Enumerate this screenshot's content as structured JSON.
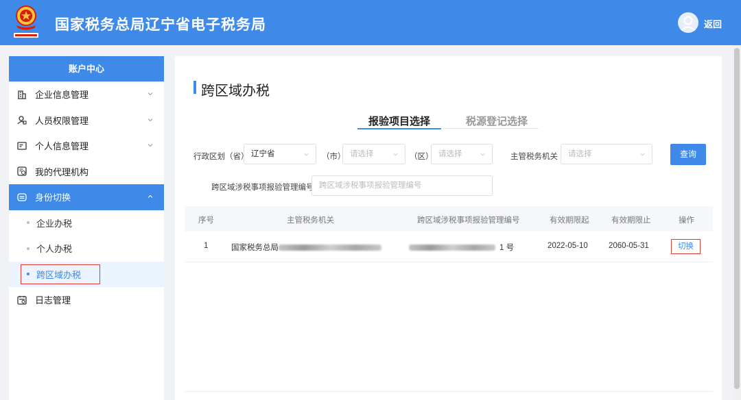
{
  "header": {
    "title": "国家税务总局辽宁省电子税务局",
    "back_label": "返回"
  },
  "sidebar": {
    "heading": "账户中心",
    "items": [
      {
        "label": "企业信息管理",
        "icon": "building-icon"
      },
      {
        "label": "人员权限管理",
        "icon": "user-lock-icon"
      },
      {
        "label": "个人信息管理",
        "icon": "id-card-icon"
      },
      {
        "label": "我的代理机构",
        "icon": "agency-icon"
      },
      {
        "label": "身份切换",
        "icon": "switch-icon"
      }
    ],
    "sub_items": [
      "企业办税",
      "个人办税",
      "跨区域办税"
    ],
    "last_item": {
      "label": "日志管理",
      "icon": "log-icon"
    }
  },
  "main": {
    "title": "跨区域办税",
    "tabs": [
      "报验项目选择",
      "税源登记选择"
    ],
    "filters": {
      "region_label": "行政区划（省）",
      "province_value": "辽宁省",
      "city_label": "（市）",
      "city_placeholder": "请选择",
      "district_label": "（区）",
      "district_placeholder": "请选择",
      "authority_label": "主管税务机关",
      "authority_placeholder": "请选择",
      "query_label": "查询",
      "number_label": "跨区域涉税事项报验管理编号",
      "number_placeholder": "跨区域涉税事项报验管理编号"
    },
    "table": {
      "columns": [
        "序号",
        "主管税务机关",
        "跨区域涉税事项报验管理编号",
        "有效期限起",
        "有效期限止",
        "操作"
      ],
      "rows": [
        {
          "index": "1",
          "authority_prefix": "国家税务总局",
          "number_suffix": "1 号",
          "start": "2022-05-10",
          "end": "2060-05-31",
          "action": "切换"
        }
      ]
    }
  },
  "colors": {
    "primary": "#3f8ae8",
    "highlight": "#e53935"
  }
}
